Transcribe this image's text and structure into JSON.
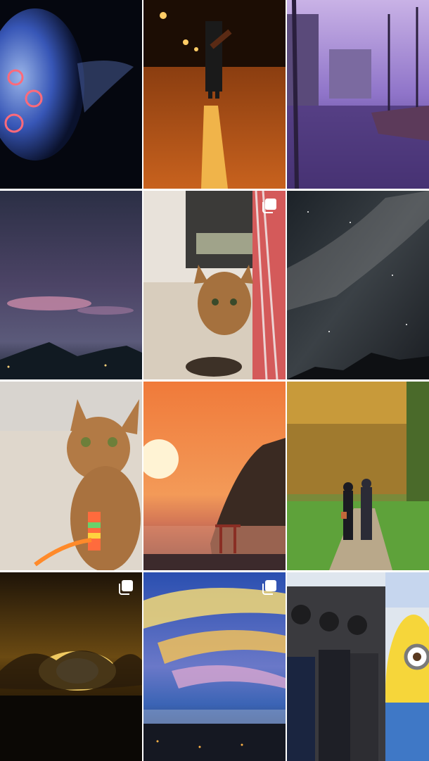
{
  "grid": {
    "tiles": [
      {
        "subject": "jellyfish",
        "multiple": false
      },
      {
        "subject": "guitarist-on-night-road",
        "multiple": false
      },
      {
        "subject": "harbor-boats-purple-dusk",
        "multiple": false
      },
      {
        "subject": "evening-clouds-over-hills",
        "multiple": false
      },
      {
        "subject": "cat-on-rug",
        "multiple": true
      },
      {
        "subject": "milky-way-over-mountain",
        "multiple": false
      },
      {
        "subject": "cat-with-collar-tag",
        "multiple": false
      },
      {
        "subject": "sunset-torii-coast",
        "multiple": false
      },
      {
        "subject": "couple-walking-autumn-path",
        "multiple": false
      },
      {
        "subject": "sun-behind-dark-clouds",
        "multiple": true
      },
      {
        "subject": "painted-sky-town",
        "multiple": true
      },
      {
        "subject": "crowd-with-minion",
        "multiple": false
      }
    ],
    "multi_icon": "multiple-photos-icon"
  }
}
